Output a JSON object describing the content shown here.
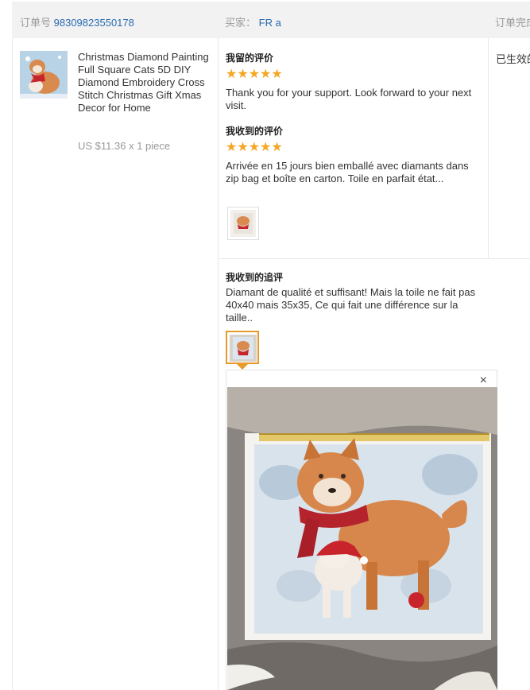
{
  "header": {
    "order_label": "订单号",
    "order_number": "98309823550178",
    "buyer_label": "买家：",
    "buyer_name": "FR a",
    "status_label": "订单完成"
  },
  "product": {
    "title": "Christmas Diamond Painting Full Square Cats 5D DIY Diamond Embroidery Cross Stitch Christmas Gift Xmas Decor for Home",
    "price": "US $11.36 x 1 piece"
  },
  "my_review": {
    "heading": "我留的评价",
    "stars": "★★★★★",
    "text": "Thank you for your support. Look forward to your next visit."
  },
  "received_review": {
    "heading": "我收到的评价",
    "stars": "★★★★★",
    "text": "Arrivée en 15 jours bien emballé avec diamants dans zip bag et boîte en carton. Toile en parfait état..."
  },
  "followup_review": {
    "heading": "我收到的追评",
    "text": "Diamant de qualité et suffisant! Mais la toile ne fait pas 40x40 mais 35x35, Ce qui fait une différence sur la taille.."
  },
  "status": {
    "text": "已生效的"
  },
  "viewer": {
    "close": "×"
  }
}
